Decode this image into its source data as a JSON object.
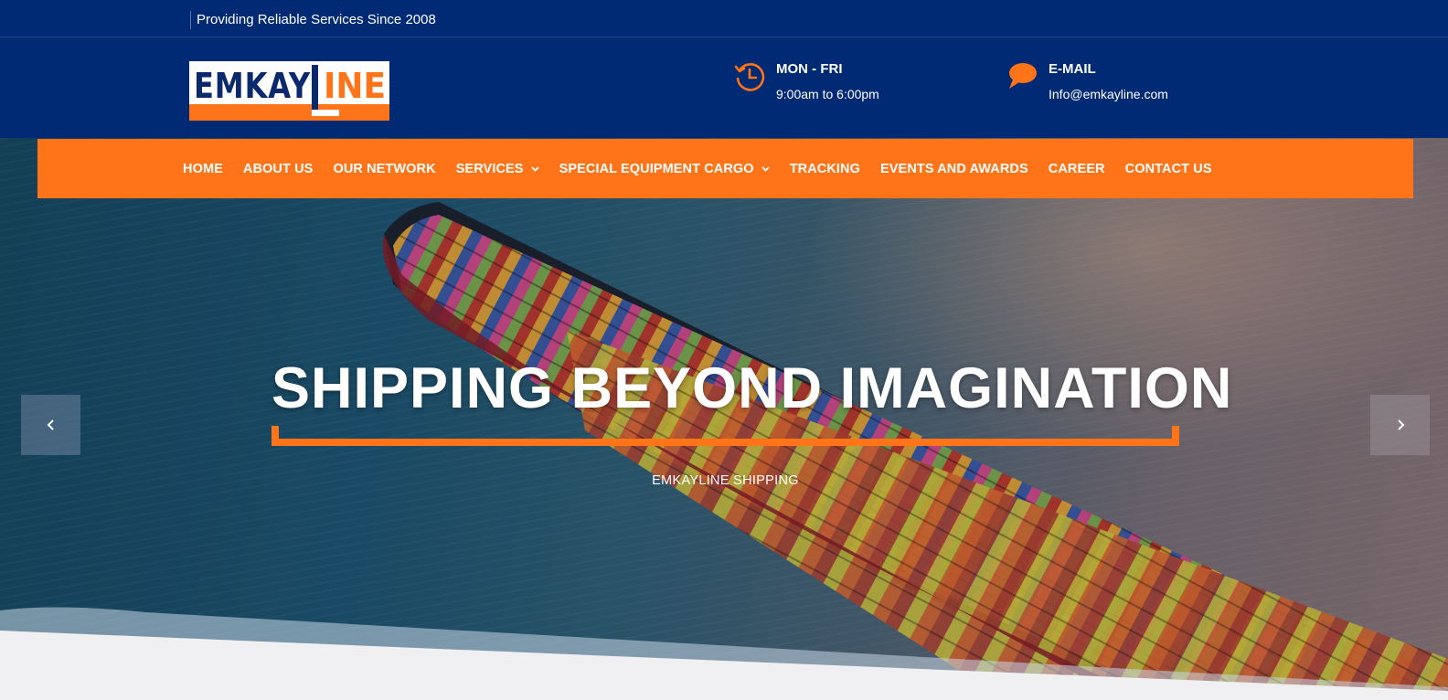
{
  "topbar": {
    "tagline": "Providing Reliable Services Since 2008"
  },
  "header": {
    "logo_text": "EM KAY LINE",
    "hours": {
      "icon": "clock-history-icon",
      "title": "MON - FRI",
      "value": "9:00am to 6:00pm"
    },
    "email": {
      "icon": "chat-bubble-icon",
      "title": "E-MAIL",
      "value": "Info@emkayline.com"
    }
  },
  "nav": {
    "items": [
      {
        "label": "HOME"
      },
      {
        "label": "ABOUT US"
      },
      {
        "label": "OUR NETWORK"
      },
      {
        "label": "SERVICES",
        "has_dropdown": true
      },
      {
        "label": "SPECIAL EQUIPMENT CARGO",
        "has_dropdown": true
      },
      {
        "label": "TRACKING"
      },
      {
        "label": "EVENTS AND AWARDS"
      },
      {
        "label": "CAREER"
      },
      {
        "label": "CONTACT US"
      }
    ]
  },
  "hero": {
    "headline": "SHIPPING BEYOND IMAGINATION",
    "subtitle": "EMKAYLINE SHIPPING",
    "prev_icon": "chevron-left-icon",
    "next_icon": "chevron-right-icon"
  },
  "colors": {
    "navy": "#002a73",
    "accent_orange": "#ff7418",
    "white": "#ffffff"
  }
}
